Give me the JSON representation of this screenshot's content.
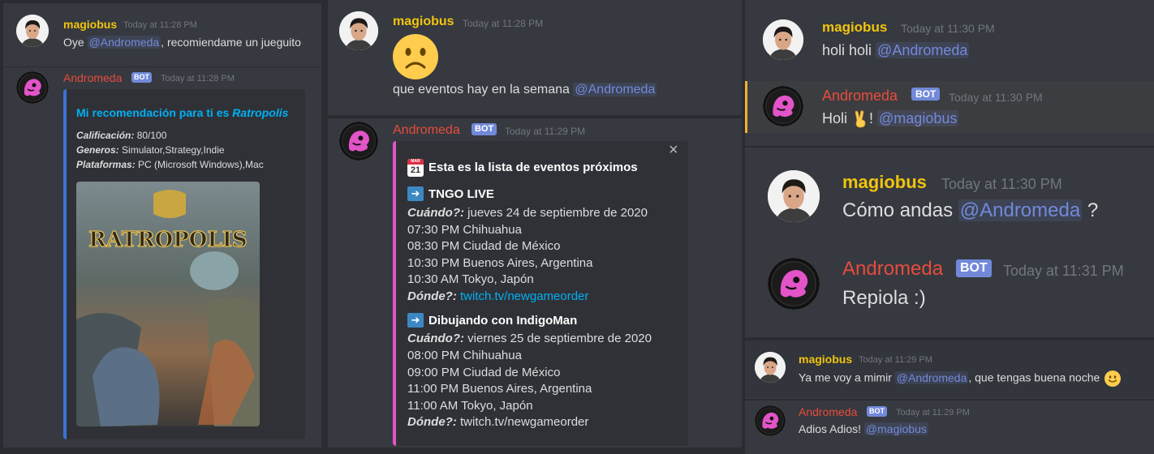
{
  "panel1": {
    "user_msg": {
      "author": "magiobus",
      "timestamp": "Today at 11:28 PM",
      "text_before": "Oye ",
      "mention": "@Andromeda",
      "text_after": ", recomiendame un jueguito"
    },
    "bot_msg": {
      "author": "Andromeda",
      "bot_tag": "BOT",
      "timestamp": "Today at 11:28 PM",
      "embed": {
        "title_prefix": "Mi recomendación para ti es ",
        "title_game": "Ratropolis",
        "rows": [
          {
            "label": "Calificación:",
            "value": " 80/100"
          },
          {
            "label": "Generos:",
            "value": " Simulator,Strategy,Indie"
          },
          {
            "label": "Plataformas:",
            "value": " PC (Microsoft Windows),Mac"
          }
        ],
        "image_title": "RATROPOLIS",
        "accent_color": "#3a72d8"
      }
    }
  },
  "panel2": {
    "user_msg": {
      "author": "magiobus",
      "timestamp": "Today at 11:28 PM",
      "emoji": "frowning-face",
      "text": "que eventos hay en la semana ",
      "mention": "@Andromeda"
    },
    "bot_msg": {
      "author": "Andromeda",
      "bot_tag": "BOT",
      "timestamp": "Today at 11:29 PM",
      "embed": {
        "accent_color": "#e254c8",
        "calendar_month": "MAR",
        "calendar_day": "21",
        "title": "Esta es la lista de eventos próximos",
        "events": [
          {
            "name": "TNGO LIVE",
            "when_label": "Cuándo?:",
            "when_value": " jueves 24 de septiembre de 2020",
            "times": [
              "07:30 PM Chihuahua",
              "08:30 PM Ciudad de México",
              "10:30 PM Buenos Aires, Argentina",
              "10:30 AM Tokyo, Japón"
            ],
            "where_label": "Dónde?:",
            "where_value": " twitch.tv/newgameorder"
          },
          {
            "name": "Dibujando con IndigoMan",
            "when_label": "Cuándo?:",
            "when_value": " viernes 25 de septiembre de 2020",
            "times": [
              "08:00 PM Chihuahua",
              "09:00 PM Ciudad de México",
              "11:00 PM Buenos Aires, Argentina",
              "11:00 AM Tokyo, Japón"
            ],
            "where_label": "Dónde?:",
            "where_value": " twitch.tv/newgameorder"
          }
        ]
      }
    }
  },
  "panel3": {
    "user_msg": {
      "author": "magiobus",
      "timestamp": "Today at 11:30 PM",
      "text": "holi holi ",
      "mention": "@Andromeda"
    },
    "bot_msg": {
      "author": "Andromeda",
      "bot_tag": "BOT",
      "timestamp": "Today at 11:30 PM",
      "text_before": "Holi ",
      "emoji": "victory-hand",
      "text_mid": "! ",
      "mention": "@magiobus"
    }
  },
  "panel4": {
    "user_msg": {
      "author": "magiobus",
      "timestamp": "Today at 11:30 PM",
      "text_before": "Cómo andas ",
      "mention": "@Andromeda",
      "text_after": " ?"
    },
    "bot_msg": {
      "author": "Andromeda",
      "bot_tag": "BOT",
      "timestamp": "Today at 11:31 PM",
      "text": "Repiola :)"
    }
  },
  "panel5": {
    "user_msg": {
      "author": "magiobus",
      "timestamp": "Today at 11:29 PM",
      "text_before": "Ya me voy a mimir ",
      "mention": "@Andromeda",
      "text_after": ", que tengas buena noche",
      "emoji": "slightly-smiling-face"
    },
    "bot_msg": {
      "author": "Andromeda",
      "bot_tag": "BOT",
      "timestamp": "Today at 11:29 PM",
      "text": "Adios Adios! ",
      "mention": "@magiobus"
    }
  },
  "colors": {
    "background": "#36393f",
    "user_name": "#f1c40f",
    "bot_name": "#e74c3c",
    "mention": "#7289da",
    "link": "#00b0f4"
  }
}
